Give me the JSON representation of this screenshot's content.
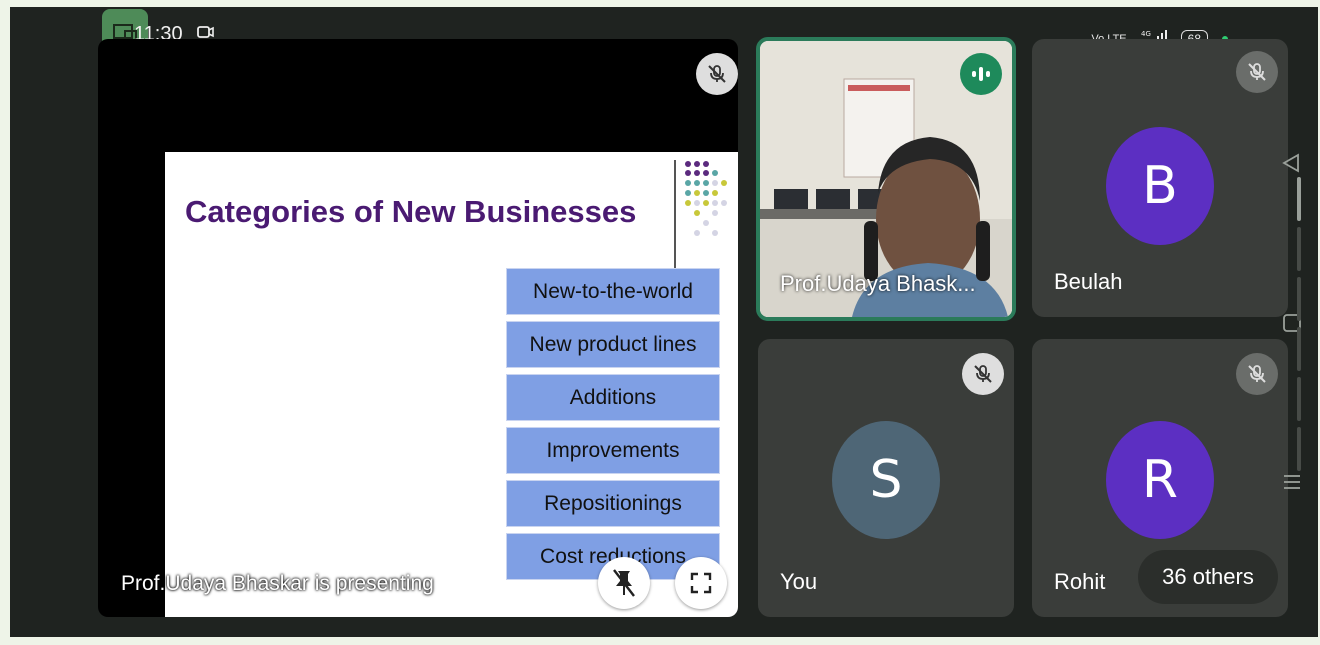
{
  "status_bar": {
    "time": "11:30",
    "network": "Vo LTE",
    "signal": "4G",
    "battery": "68"
  },
  "presentation": {
    "presenting_label": "Prof.Udaya Bhaskar is presenting",
    "slide": {
      "title": "Categories of New Businesses",
      "categories": [
        "New-to-the-world",
        "New product lines",
        "Additions",
        "Improvements",
        "Repositionings",
        "Cost reductions"
      ]
    }
  },
  "participants": {
    "prof": {
      "name": "Prof.Udaya Bhask..."
    },
    "beulah": {
      "name": "Beulah",
      "initial": "B",
      "color": "#5c2fc2"
    },
    "you": {
      "name": "You",
      "initial": "S",
      "color": "#4e6676"
    },
    "rohit": {
      "name": "Rohit",
      "initial": "R",
      "color": "#5c2fc2"
    }
  },
  "others_label": "36 others",
  "colors": {
    "speaking_border": "#2b7b5a",
    "slide_title": "#4a1a72",
    "category_box": "#7f9fe4"
  }
}
